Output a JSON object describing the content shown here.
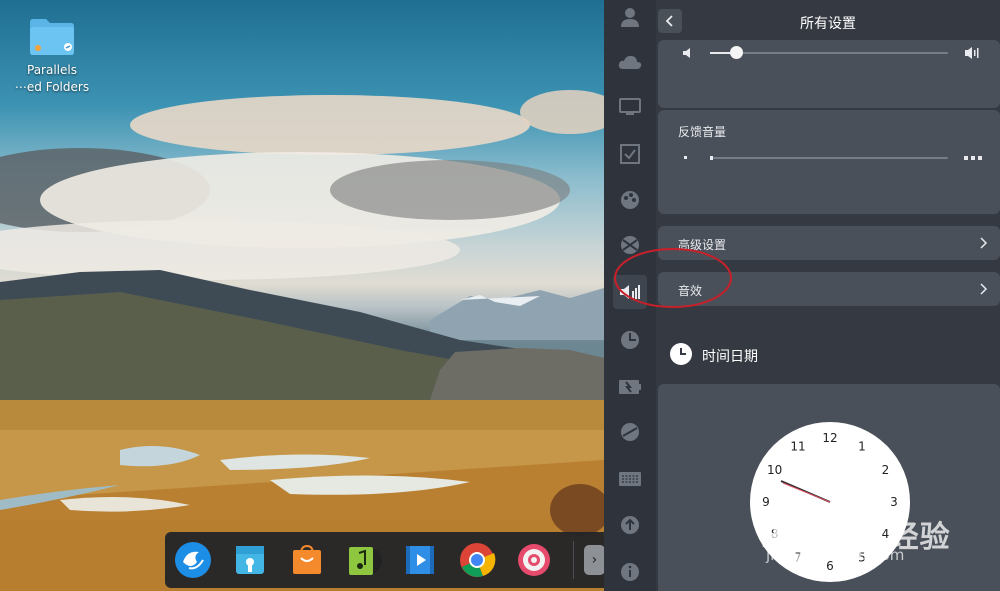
{
  "desktop": {
    "icon_label_line1": "Parallels",
    "icon_label_line2": "⋯ed Folders"
  },
  "dock": {
    "items": [
      "deepin-launcher-icon",
      "file-manager-icon",
      "app-store-icon",
      "music-icon",
      "video-icon",
      "chrome-icon",
      "settings-icon"
    ],
    "more_label": "›"
  },
  "settings": {
    "title": "所有设置",
    "rail_icons": [
      "account-icon",
      "cloud-icon",
      "display-icon",
      "default-apps-icon",
      "personalization-icon",
      "network-icon",
      "sound-icon",
      "datetime-icon",
      "power-icon",
      "mouse-icon",
      "keyboard-icon",
      "update-icon",
      "info-icon"
    ],
    "feedback_volume_label": "反馈音量",
    "advanced_label": "高级设置",
    "sound_effects_label": "音效",
    "datetime_title": "时间日期",
    "clock_numbers": [
      "12",
      "1",
      "2",
      "3",
      "4",
      "5",
      "6",
      "7",
      "8",
      "9",
      "10",
      "11"
    ]
  },
  "watermark": {
    "brand": "Bai¸du 经验",
    "url": "jingyan.baidu.com"
  },
  "colors": {
    "accent": "#ffffff",
    "annotation": "#c8202a"
  }
}
